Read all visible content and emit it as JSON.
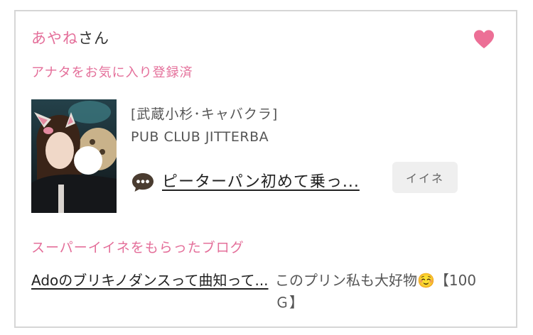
{
  "user": {
    "name": "あやね",
    "honorific": "さん"
  },
  "favorite_status": "アナタをお気に入り登録済",
  "favorite_icon": "heart-icon",
  "accent_color": "#e46f9a",
  "shop": {
    "area": "[武蔵小杉･キャバクラ]",
    "name": "PUB CLUB JITTERBA"
  },
  "latest_blog": {
    "icon": "speech-bubble-icon",
    "title": "ピーターパン初めて乗っ...",
    "like_label": "イイネ"
  },
  "super_like_section": {
    "title": "スーパーイイネをもらったブログ",
    "item": {
      "title": "Adoのブリキノダンスって曲知って...",
      "comment": "このプリン私も大好物☺️【100Ｇ】"
    }
  }
}
